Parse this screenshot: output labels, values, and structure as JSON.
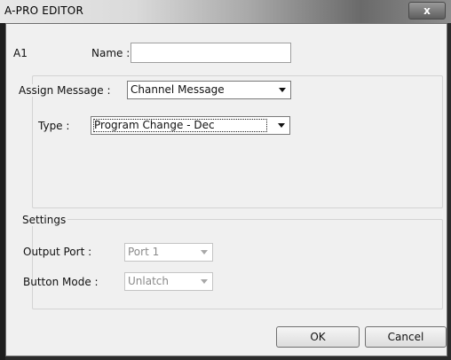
{
  "window": {
    "title": "A-PRO EDITOR",
    "close_glyph": "x"
  },
  "header": {
    "id_label": "A1",
    "name_label": "Name :",
    "name_value": ""
  },
  "assign": {
    "label": "Assign Message :",
    "selected": "Channel Message"
  },
  "type": {
    "label": "Type :",
    "selected": "Program Change - Dec"
  },
  "settings": {
    "title": "Settings",
    "output_port_label": "Output Port :",
    "output_port_value": "Port 1",
    "button_mode_label": "Button Mode :",
    "button_mode_value": "Unlatch"
  },
  "buttons": {
    "ok": "OK",
    "cancel": "Cancel"
  }
}
